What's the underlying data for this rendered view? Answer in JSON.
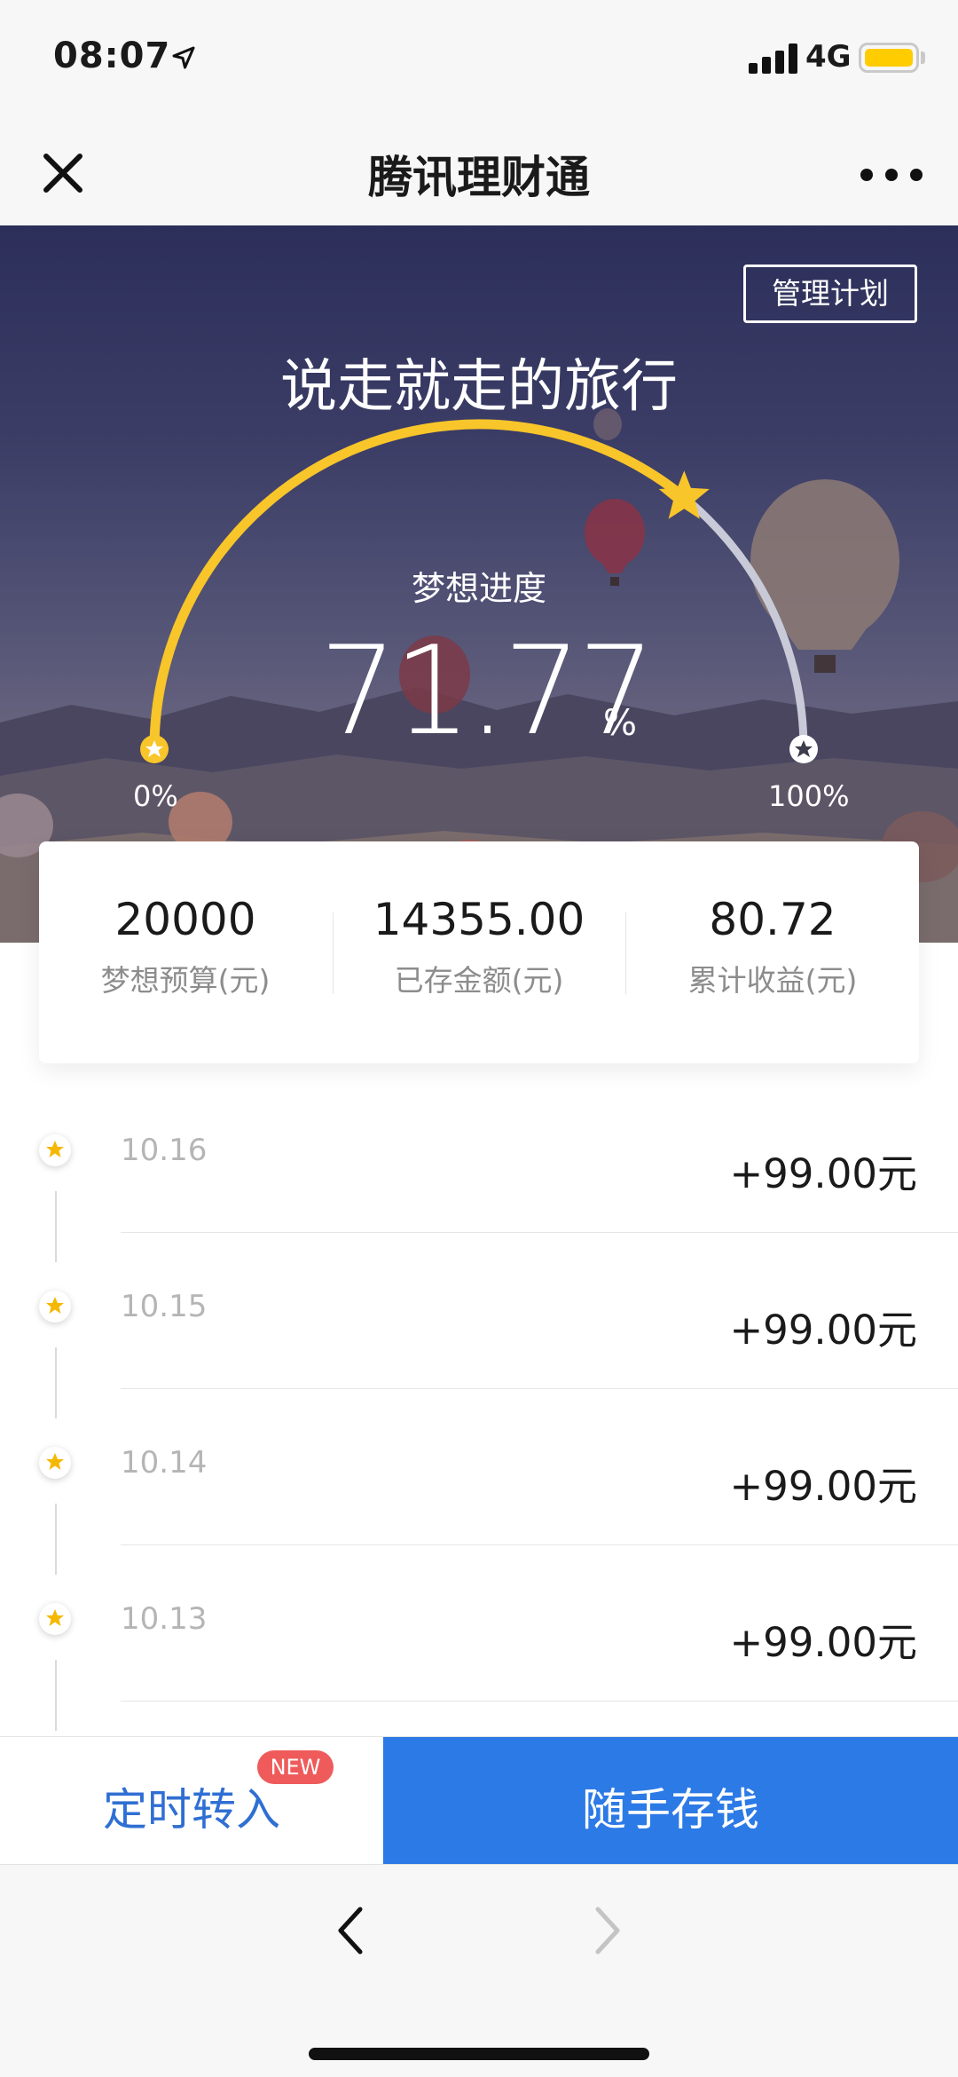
{
  "status_bar": {
    "time": "08:07",
    "network": "4G",
    "location_icon": "location-arrow-icon",
    "signal_icon": "signal-bars-icon",
    "battery_icon": "battery-icon",
    "battery_color": "#ffcc00"
  },
  "nav": {
    "title": "腾讯理财通",
    "close_icon": "close-icon",
    "more_icon": "more-dots-icon"
  },
  "hero": {
    "manage_label": "管理计划",
    "plan_title": "说走就走的旅行",
    "progress_label": "梦想进度",
    "progress_value": "71.77",
    "progress_unit": "%",
    "progress_fraction": 0.7177,
    "scale_start": "0%",
    "scale_end": "100%",
    "accent_color": "#f8c52a",
    "marker_icon": "star-icon"
  },
  "summary": {
    "items": [
      {
        "value": "20000",
        "label": "梦想预算(元)"
      },
      {
        "value": "14355.00",
        "label": "已存金额(元)"
      },
      {
        "value": "80.72",
        "label": "累计收益(元)"
      }
    ]
  },
  "records": [
    {
      "date": "10.16",
      "amount": "+99.00元"
    },
    {
      "date": "10.15",
      "amount": "+99.00元"
    },
    {
      "date": "10.14",
      "amount": "+99.00元"
    },
    {
      "date": "10.13",
      "amount": "+99.00元"
    }
  ],
  "actions": {
    "scheduled_label": "定时转入",
    "new_badge": "NEW",
    "deposit_label": "随手存钱",
    "primary_color": "#2c7ae6",
    "link_color": "#2f6fd3"
  },
  "toolbar": {
    "back_icon": "chevron-left-icon",
    "forward_icon": "chevron-right-icon"
  }
}
